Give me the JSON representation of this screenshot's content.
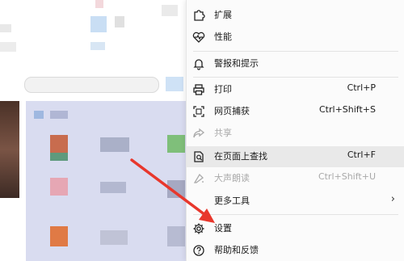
{
  "menu": {
    "items": [
      {
        "id": "extensions",
        "label": "扩展",
        "shortcut": "",
        "icon": "puzzle-icon",
        "disabled": false,
        "highlight": false,
        "submenu": false
      },
      {
        "id": "performance",
        "label": "性能",
        "shortcut": "",
        "icon": "heartbeat-icon",
        "disabled": false,
        "highlight": false,
        "submenu": false
      },
      {
        "id": "alerts",
        "label": "警报和提示",
        "shortcut": "",
        "icon": "bell-icon",
        "disabled": false,
        "highlight": false,
        "submenu": false
      },
      {
        "id": "print",
        "label": "打印",
        "shortcut": "Ctrl+P",
        "icon": "printer-icon",
        "disabled": false,
        "highlight": false,
        "submenu": false
      },
      {
        "id": "web-capture",
        "label": "网页捕获",
        "shortcut": "Ctrl+Shift+S",
        "icon": "capture-icon",
        "disabled": false,
        "highlight": false,
        "submenu": false
      },
      {
        "id": "share",
        "label": "共享",
        "shortcut": "",
        "icon": "share-icon",
        "disabled": true,
        "highlight": false,
        "submenu": false
      },
      {
        "id": "find",
        "label": "在页面上查找",
        "shortcut": "Ctrl+F",
        "icon": "find-icon",
        "disabled": false,
        "highlight": true,
        "submenu": false
      },
      {
        "id": "read-aloud",
        "label": "大声朗读",
        "shortcut": "Ctrl+Shift+U",
        "icon": "read-aloud-icon",
        "disabled": true,
        "highlight": false,
        "submenu": false
      },
      {
        "id": "more-tools",
        "label": "更多工具",
        "shortcut": "",
        "icon": "tools-icon",
        "disabled": false,
        "highlight": false,
        "submenu": true
      },
      {
        "id": "settings",
        "label": "设置",
        "shortcut": "",
        "icon": "gear-icon",
        "disabled": false,
        "highlight": false,
        "submenu": false
      },
      {
        "id": "help",
        "label": "帮助和反馈",
        "shortcut": "",
        "icon": "help-icon",
        "disabled": false,
        "highlight": false,
        "submenu": false
      }
    ],
    "submenu_glyph": "›"
  },
  "annotation": {
    "arrow_color": "#e8372c"
  },
  "background": {
    "panel_color": "#d9dcf0"
  }
}
